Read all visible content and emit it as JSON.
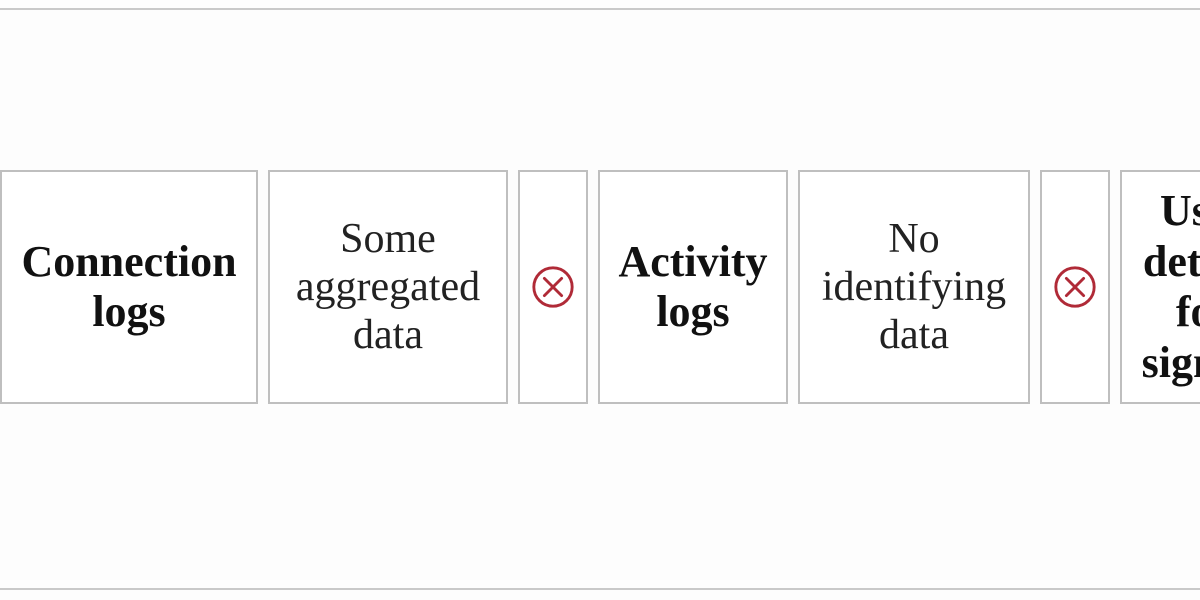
{
  "table": {
    "cells": [
      {
        "name": "cell-connection-logs",
        "style": "bold",
        "text": "Connection logs"
      },
      {
        "name": "cell-some-aggregated",
        "style": "plain",
        "text": "Some aggregated data"
      },
      {
        "name": "cell-status-1",
        "style": "icon",
        "icon": "circle-x-icon"
      },
      {
        "name": "cell-activity-logs",
        "style": "bold",
        "text": "Activity logs"
      },
      {
        "name": "cell-no-identifying",
        "style": "plain",
        "text": "No identifying data"
      },
      {
        "name": "cell-status-2",
        "style": "icon",
        "icon": "circle-x-icon"
      },
      {
        "name": "cell-user-details",
        "style": "bold",
        "text": "User details for signup"
      }
    ]
  }
}
